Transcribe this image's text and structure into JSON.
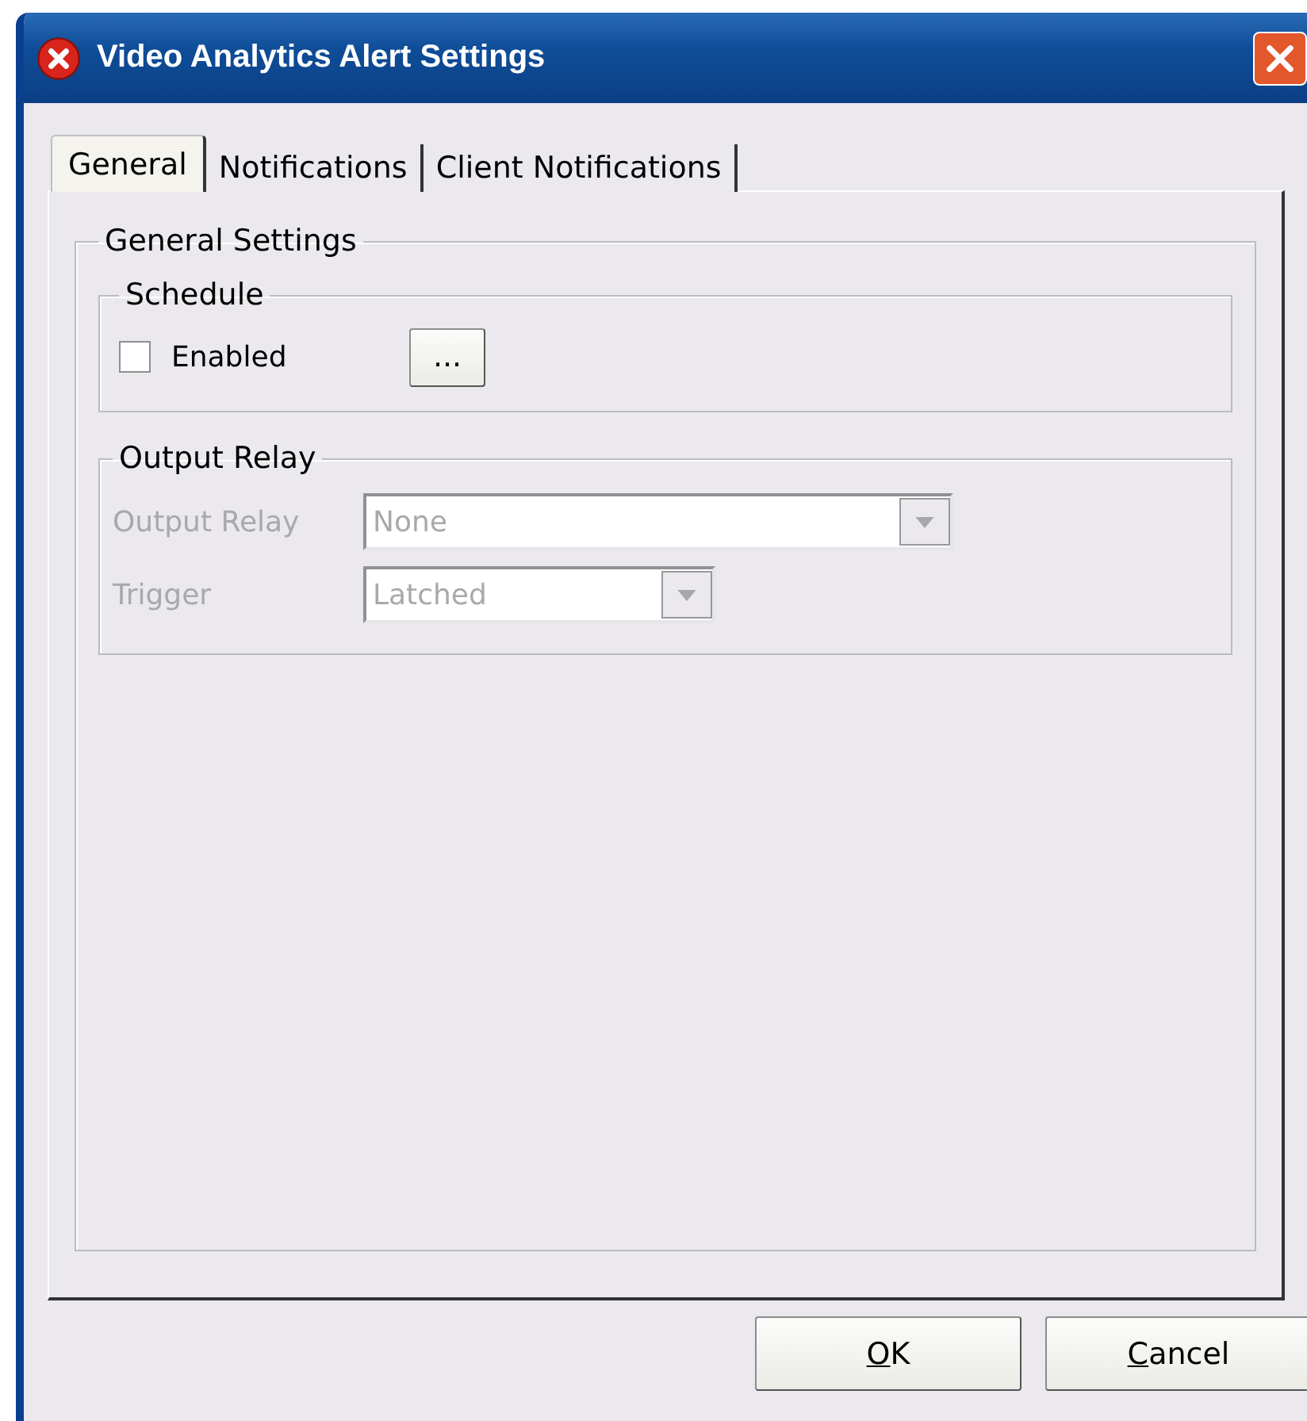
{
  "window": {
    "title": "Video Analytics Alert Settings"
  },
  "tabs": [
    {
      "label": "General",
      "selected": true
    },
    {
      "label": "Notifications",
      "selected": false
    },
    {
      "label": "Client Notifications",
      "selected": false
    }
  ],
  "general_settings": {
    "title": "General Settings",
    "schedule": {
      "title": "Schedule",
      "enabled": {
        "label": "Enabled",
        "checked": false
      },
      "button": "..."
    },
    "output_relay": {
      "title": "Output Relay",
      "disabled": true,
      "fields": [
        {
          "label": "Output Relay",
          "value": "None",
          "kind": "wide"
        },
        {
          "label": "Trigger",
          "value": "Latched",
          "kind": "narrow"
        }
      ]
    }
  },
  "buttons": [
    {
      "access_key": "O",
      "rest": "K"
    },
    {
      "access_key": "C",
      "rest": "ancel"
    }
  ]
}
